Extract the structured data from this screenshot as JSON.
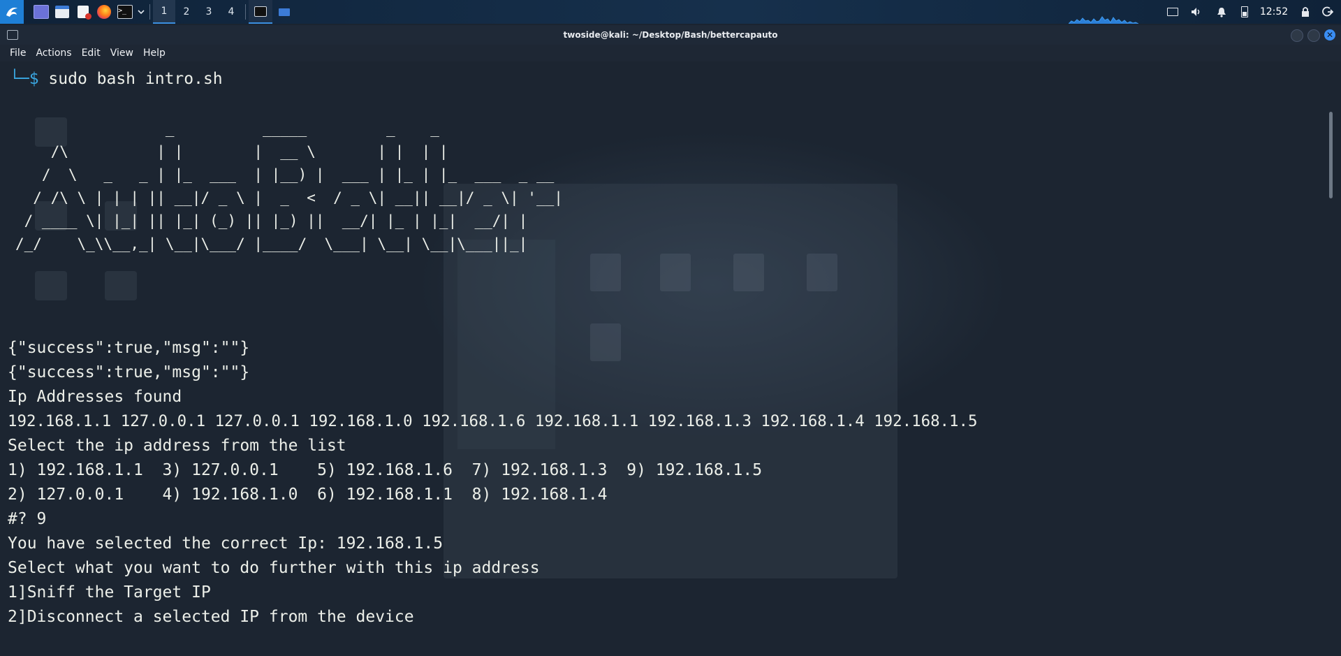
{
  "panel": {
    "workspaces": [
      "1",
      "2",
      "3",
      "4"
    ],
    "active_workspace": "1",
    "clock": "12:52"
  },
  "window": {
    "title": "twoside@kali: ~/Desktop/Bash/bettercapauto",
    "menu": [
      "File",
      "Actions",
      "Edit",
      "View",
      "Help"
    ]
  },
  "terminal": {
    "prompt_symbol": "└─$",
    "command": "sudo bash intro.sh",
    "ascii_art": "                 _          _____         _    _\n    /\\          | |        |  __ \\       | |  | |\n   /  \\   _   _ | |_  ___  | |__) |  ___ | |_ | |_  ___  _ __\n  / /\\ \\ | | | || __|/ _ \\ |  _  <  / _ \\| __|| __|/ _ \\| '__|\n / ____ \\| |_| || |_| (_) || |_) ||  __/| |_ | |_|  __/| |\n/_/    \\_\\\\__,_| \\__|\\___/ |____/  \\___| \\__| \\__|\\___||_|",
    "lines": [
      "{\"success\":true,\"msg\":\"\"}",
      "{\"success\":true,\"msg\":\"\"}",
      "Ip Addresses found",
      "192.168.1.1 127.0.0.1 127.0.0.1 192.168.1.0 192.168.1.6 192.168.1.1 192.168.1.3 192.168.1.4 192.168.1.5",
      "Select the ip address from the list",
      "1) 192.168.1.1  3) 127.0.0.1    5) 192.168.1.6  7) 192.168.1.3  9) 192.168.1.5",
      "2) 127.0.0.1    4) 192.168.1.0  6) 192.168.1.1  8) 192.168.1.4",
      "#? 9",
      "You have selected the correct Ip: 192.168.1.5",
      "Select what you want to do further with this ip address",
      "1]Sniff the Target IP",
      "2]Disconnect a selected IP from the device"
    ]
  },
  "icons": {
    "kali_menu": "kali-dragon-icon",
    "desktop": "show-desktop-icon",
    "files": "file-manager-icon",
    "editor": "text-editor-icon",
    "browser": "firefox-icon",
    "terminal": "terminal-icon",
    "tray": [
      "display-icon",
      "volume-icon",
      "notification-bell-icon",
      "battery-icon",
      "lock-icon",
      "logout-icon"
    ]
  },
  "colors": {
    "panel_bg": "#13273f",
    "terminal_bg": "#1c2531",
    "text": "#ecefe9",
    "prompt": "#3a8df2",
    "accent": "#3b8fe0"
  }
}
